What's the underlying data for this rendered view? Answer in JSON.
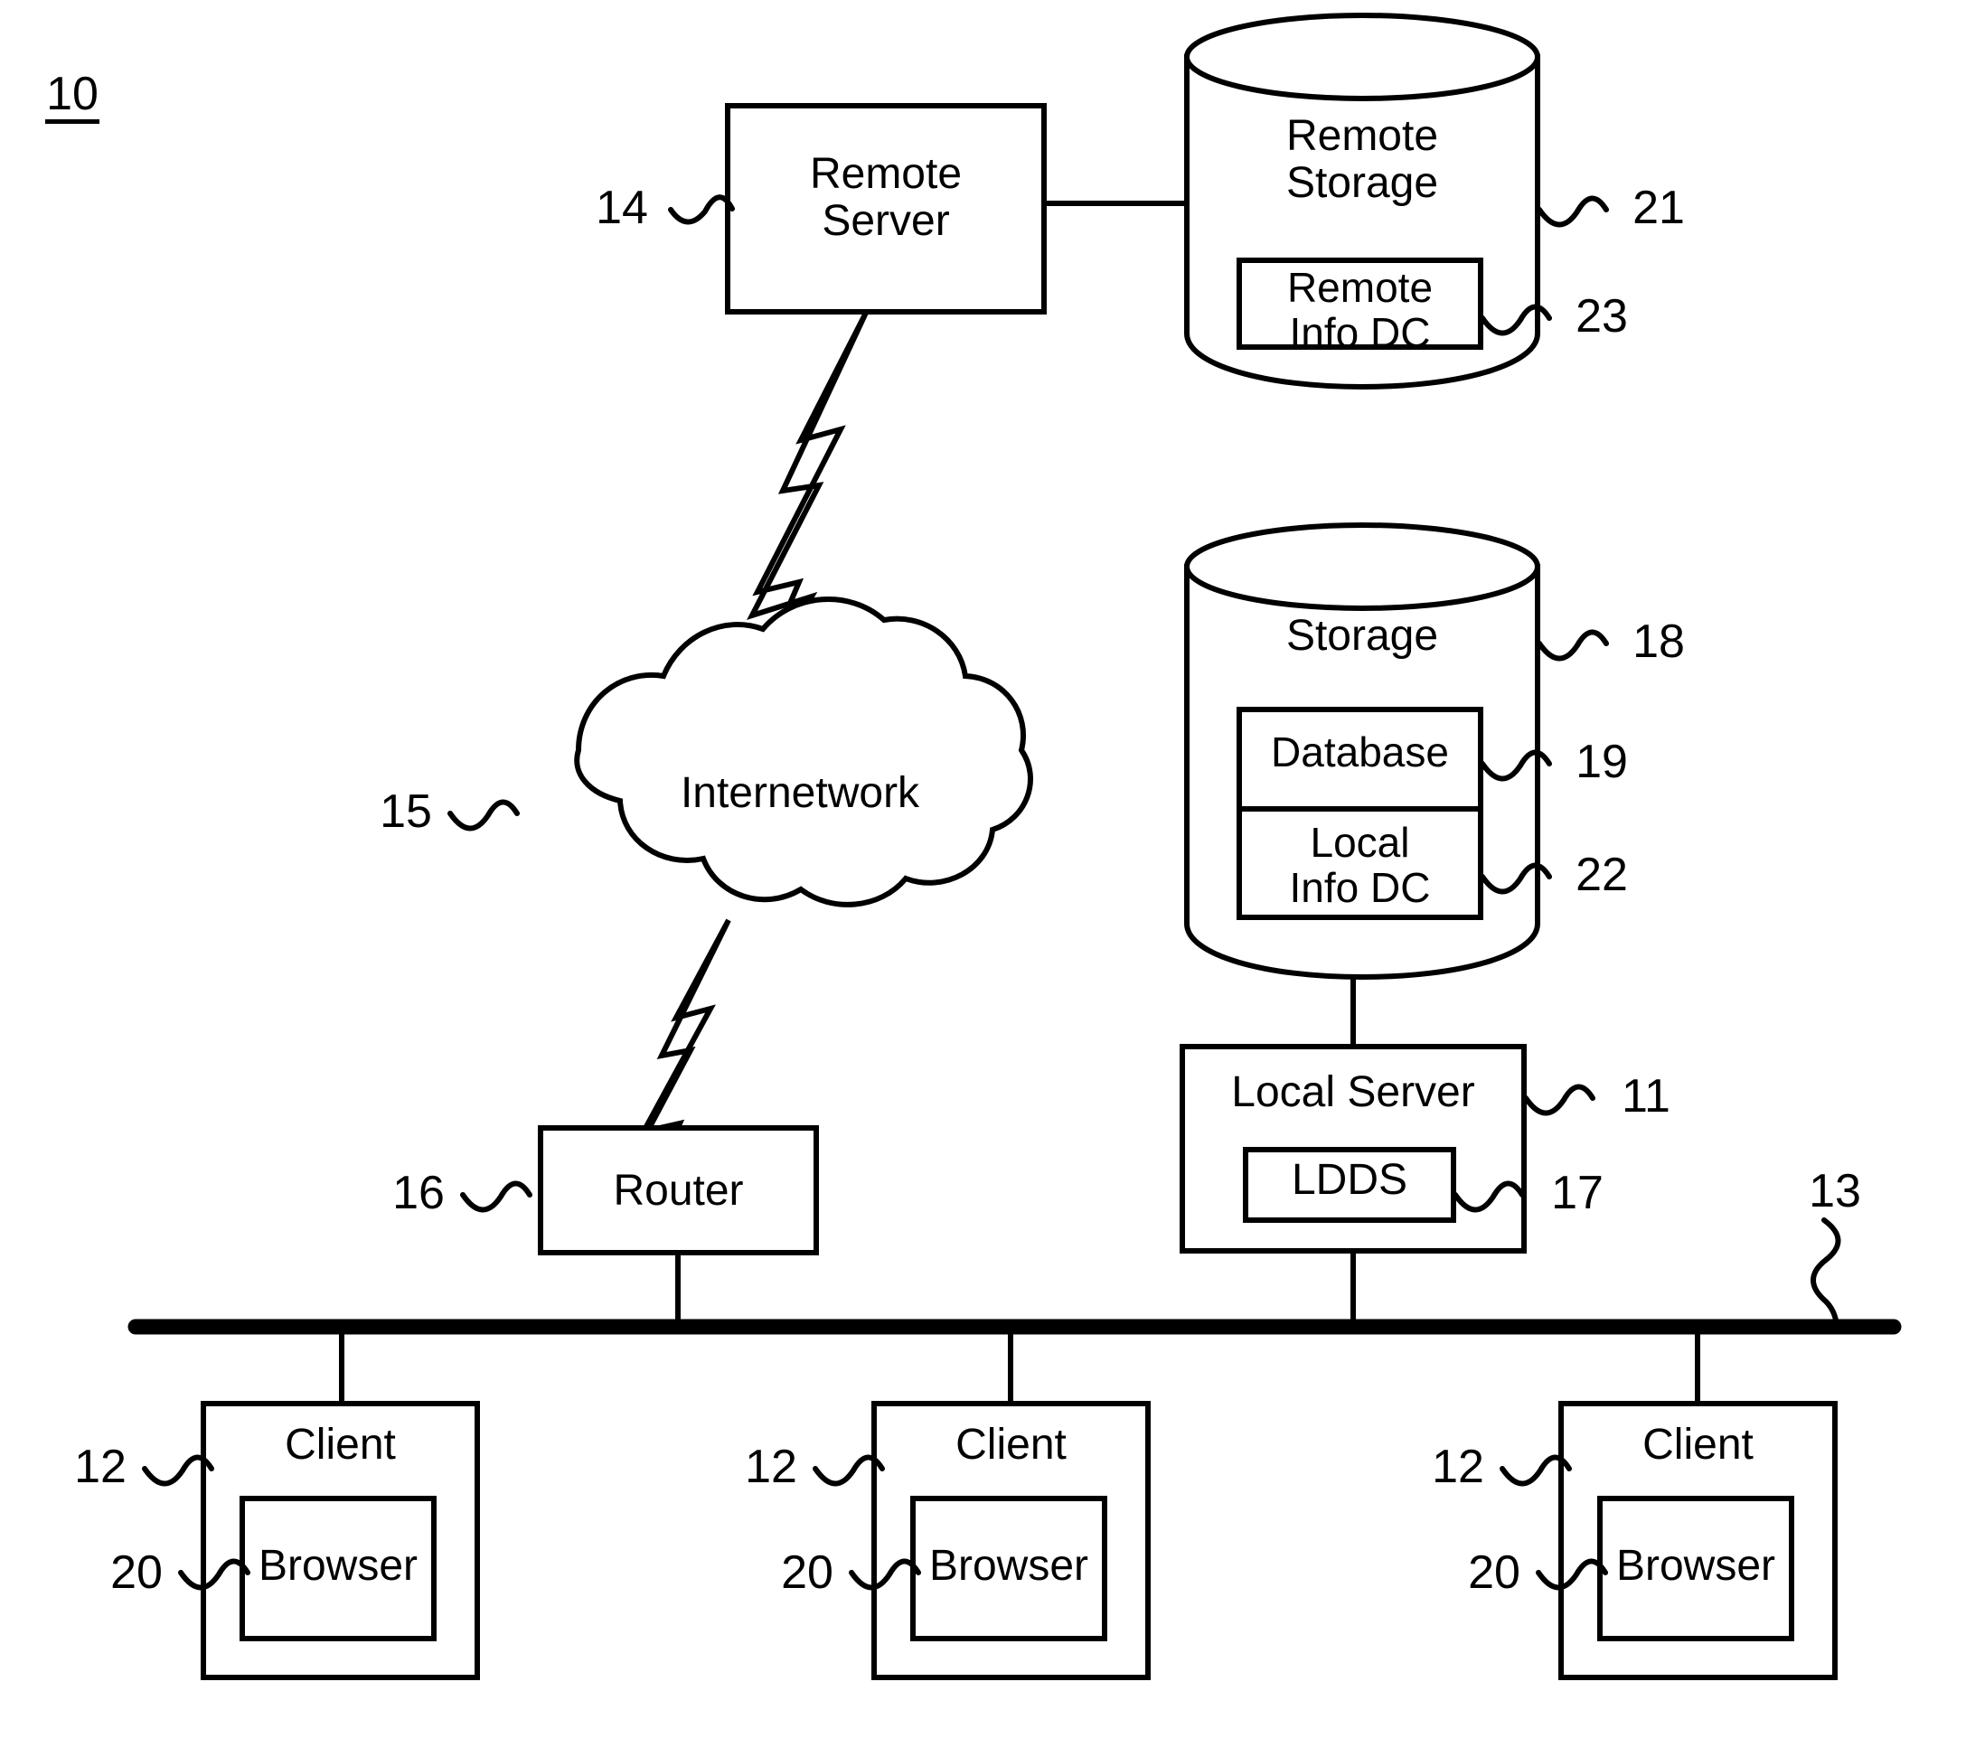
{
  "figure": {
    "number": "10",
    "type": "patent-network-diagram"
  },
  "nodes": {
    "remote_server": {
      "label": "Remote\nServer",
      "ref": "14"
    },
    "remote_storage": {
      "label": "Remote\nStorage",
      "ref": "21"
    },
    "remote_info_dc": {
      "label": "Remote\nInfo DC",
      "ref": "23"
    },
    "storage": {
      "label": "Storage",
      "ref": "18"
    },
    "database": {
      "label": "Database",
      "ref": "19"
    },
    "local_info_dc": {
      "label": "Local\nInfo DC",
      "ref": "22"
    },
    "local_server": {
      "label": "Local Server",
      "ref": "11"
    },
    "ldds": {
      "label": "LDDS",
      "ref": "17"
    },
    "internetwork": {
      "label": "Internetwork",
      "ref": "15"
    },
    "router": {
      "label": "Router",
      "ref": "16"
    },
    "network_bus": {
      "label": "",
      "ref": "13"
    },
    "client_left": {
      "label": "Client",
      "ref": "12"
    },
    "browser_left": {
      "label": "Browser",
      "ref": "20"
    },
    "client_center": {
      "label": "Client",
      "ref": "12"
    },
    "browser_center": {
      "label": "Browser",
      "ref": "20"
    },
    "client_right": {
      "label": "Client",
      "ref": "12"
    },
    "browser_right": {
      "label": "Browser",
      "ref": "20"
    }
  },
  "colors": {
    "ink": "#000000",
    "paper": "#ffffff"
  }
}
